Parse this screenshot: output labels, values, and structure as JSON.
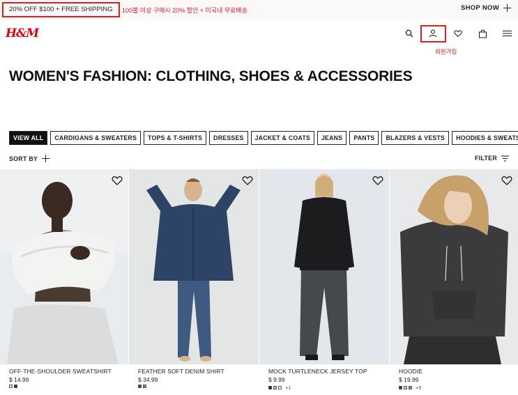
{
  "promo": {
    "text": "20% OFF $100 + FREE SHIPPING",
    "note_ko": "100불 이상 구매시 20% 할인 + 미국내 무료배송",
    "shop_now": "SHOP NOW"
  },
  "header": {
    "logo": "H&M",
    "account_note": "회원가입",
    "icons": [
      "search-icon",
      "account-icon",
      "heart-icon",
      "bag-icon",
      "menu-icon"
    ]
  },
  "page": {
    "title": "WOMEN'S FASHION: CLOTHING, SHOES & ACCESSORIES"
  },
  "categories": [
    "VIEW ALL",
    "CARDIGANS & SWEATERS",
    "TOPS & T-SHIRTS",
    "DRESSES",
    "JACKET & COATS",
    "JEANS",
    "PANTS",
    "BLAZERS & VESTS",
    "HOODIES & SWEATSHIRTS"
  ],
  "controls": {
    "sort_by": "SORT BY",
    "filter": "FILTER"
  },
  "products": [
    {
      "name": "OFF-THE-SHOULDER SWEATSHIRT",
      "price": "$ 14.99",
      "swatches": [
        "#e6e6e6",
        "#2a2a2a"
      ],
      "more": ""
    },
    {
      "name": "FEATHER SOFT DENIM SHIRT",
      "price": "$ 34.99",
      "swatches": [
        "#2f4a6e",
        "#6f88a6"
      ],
      "more": ""
    },
    {
      "name": "MOCK TURTLENECK JERSEY TOP",
      "price": "$ 9.99",
      "swatches": [
        "#1e1e1e",
        "#b9b9b9",
        "#ffffff"
      ],
      "more": "+1"
    },
    {
      "name": "HOODIE",
      "price": "$ 19.99",
      "swatches": [
        "#3a3a3a",
        "#cfcfcf",
        "#8c8c8c"
      ],
      "more": "+5"
    }
  ],
  "colors": {
    "brand": "#e50010",
    "annotation": "#e0201e"
  }
}
